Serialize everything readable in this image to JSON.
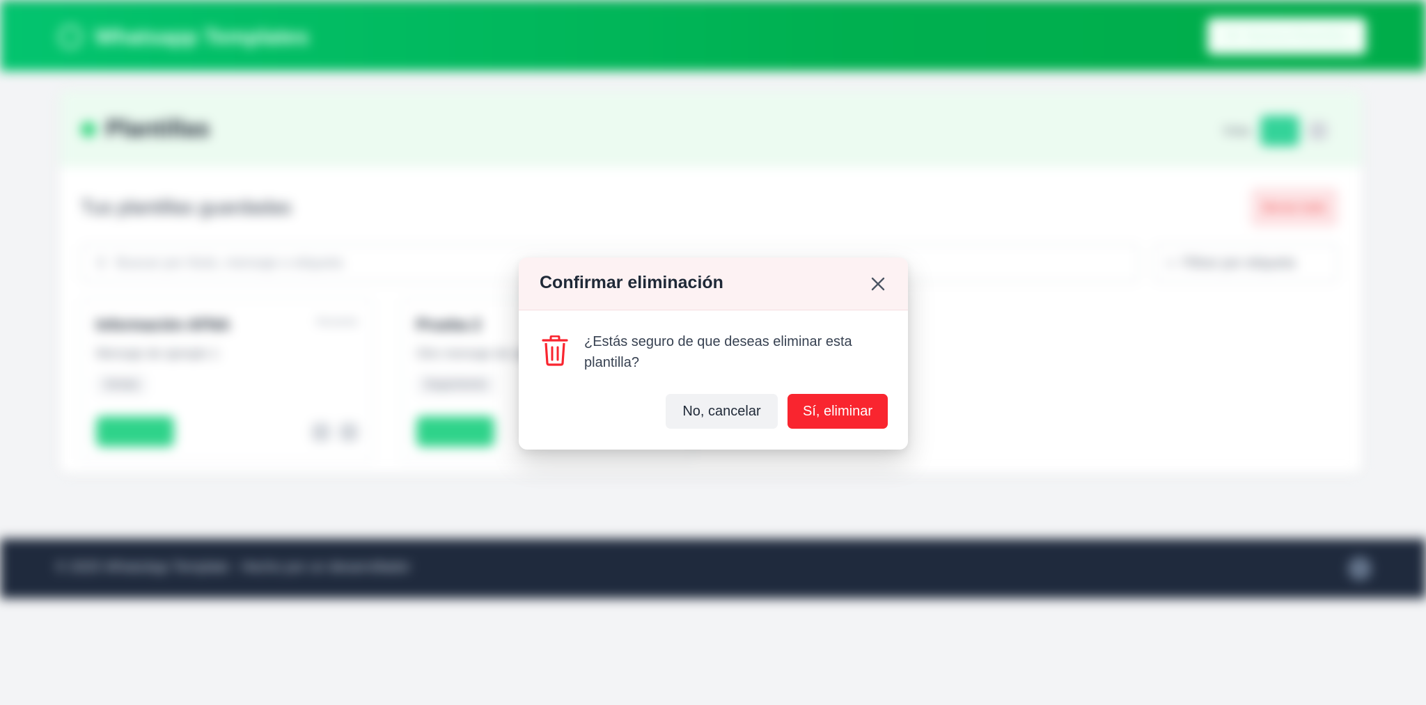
{
  "header": {
    "app_title": "Whatsapp Templates",
    "new_button_label": "Nueva Plantilla",
    "icons": {
      "brand": "whatsapp-icon",
      "add": "plus-icon"
    }
  },
  "main": {
    "section_title": "Plantillas",
    "view_label": "Vista",
    "saved_title": "Tus plantillas guardadas",
    "delete_all_label": "Borrar todo",
    "search_placeholder": "Buscar por título, mensaje o etiqueta",
    "filter_label": "Filtrar por etiqueta",
    "templates": [
      {
        "name": "Información AFNA",
        "date": "Reciente",
        "desc": "Mensaje de ejemplo 1",
        "tag": "Ventas"
      },
      {
        "name": "Prueba 2",
        "date": "",
        "desc": "Otro mensaje de ejemplo",
        "tag": "Seguimiento"
      }
    ]
  },
  "footer": {
    "text": "© 2025 WhatsApp Template · Hecho por un desarrollador"
  },
  "modal": {
    "title": "Confirmar eliminación",
    "message": "¿Estás seguro de que deseas eliminar esta plantilla?",
    "cancel_label": "No, cancelar",
    "confirm_label": "Sí, eliminar",
    "icons": {
      "close": "close-icon",
      "warning": "trash-icon"
    }
  },
  "colors": {
    "header_green": "#00b050",
    "danger_red": "#f9252f",
    "modal_header_bg": "#fdf2f3",
    "footer_bg": "#1f2a3d"
  }
}
